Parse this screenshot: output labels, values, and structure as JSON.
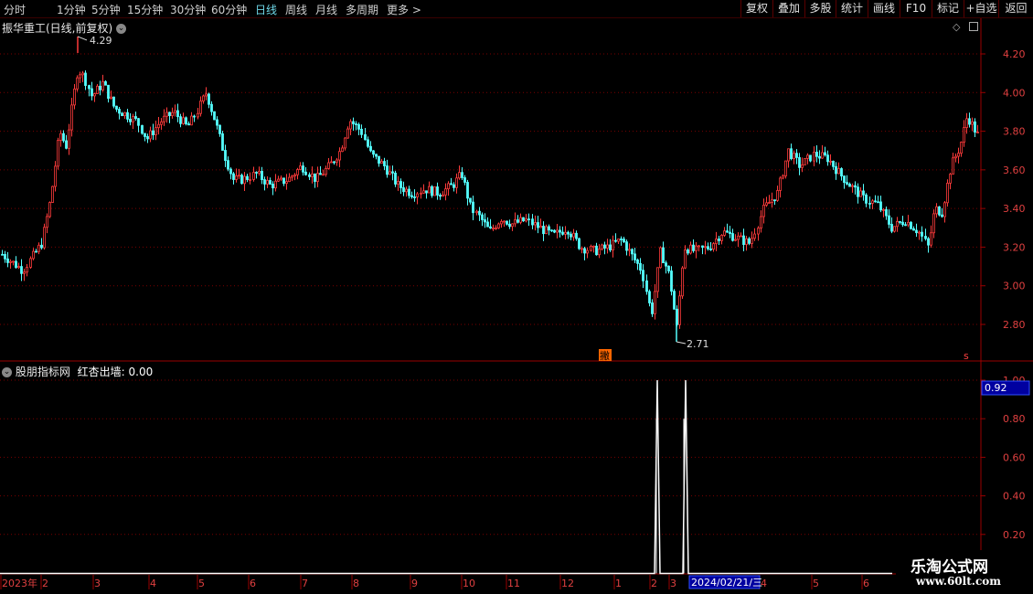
{
  "toolbar": {
    "periods": [
      "分时",
      "1分钟",
      "5分钟",
      "15分钟",
      "30分钟",
      "60分钟",
      "日线",
      "周线",
      "月线",
      "多周期",
      "更多 >"
    ],
    "active_period": "日线",
    "right_buttons": [
      "复权",
      "叠加",
      "多股",
      "统计",
      "画线",
      "F10",
      "标记",
      "+自选",
      "返回"
    ]
  },
  "main_chart": {
    "title": "振华重工(日线,前复权)",
    "y_axis_labels": [
      "4.20",
      "4.00",
      "3.80",
      "3.60",
      "3.40",
      "3.20",
      "3.00",
      "2.80"
    ],
    "high_label": "4.29",
    "low_label": "2.71",
    "signal_marker": "撇",
    "s_marker": "s",
    "colors": {
      "up": "#ff3b3b",
      "down": "#54ffff",
      "grid": "#7a0000",
      "frame": "#9a0000"
    }
  },
  "indicator": {
    "title": "股朋指标网",
    "line_label": "红杏出墙:",
    "line_value": "0.00",
    "y_axis_labels": [
      "1.00",
      "0.80",
      "0.60",
      "0.40",
      "0.20"
    ],
    "cursor_value": "0.92",
    "signal_color": "#ffffff"
  },
  "x_axis": {
    "labels": [
      "2023年",
      "2",
      "3",
      "4",
      "5",
      "6",
      "7",
      "8",
      "9",
      "10",
      "11",
      "12",
      "1",
      "2",
      "3",
      "4",
      "5",
      "6"
    ],
    "cursor_date": "2024/02/21/三"
  },
  "watermark": {
    "line1": "乐淘公式网",
    "line2": "www.60lt.com"
  },
  "chart_data": {
    "type": "candlestick",
    "title": "振华重工(日线,前复权)",
    "ylim": [
      2.65,
      4.35
    ],
    "period_high": 4.29,
    "period_low": 2.71,
    "price_path": [
      [
        0,
        3.17
      ],
      [
        25,
        3.08
      ],
      [
        45,
        3.22
      ],
      [
        55,
        3.45
      ],
      [
        65,
        3.8
      ],
      [
        72,
        3.72
      ],
      [
        85,
        4.12
      ],
      [
        92,
        4.08
      ],
      [
        100,
        3.98
      ],
      [
        112,
        4.05
      ],
      [
        125,
        3.92
      ],
      [
        140,
        3.88
      ],
      [
        150,
        3.85
      ],
      [
        160,
        3.76
      ],
      [
        175,
        3.85
      ],
      [
        190,
        3.9
      ],
      [
        205,
        3.82
      ],
      [
        215,
        3.9
      ],
      [
        225,
        4.0
      ],
      [
        235,
        3.85
      ],
      [
        245,
        3.68
      ],
      [
        255,
        3.55
      ],
      [
        265,
        3.55
      ],
      [
        280,
        3.58
      ],
      [
        295,
        3.52
      ],
      [
        315,
        3.55
      ],
      [
        330,
        3.62
      ],
      [
        345,
        3.55
      ],
      [
        360,
        3.62
      ],
      [
        372,
        3.7
      ],
      [
        382,
        3.86
      ],
      [
        395,
        3.8
      ],
      [
        405,
        3.68
      ],
      [
        420,
        3.62
      ],
      [
        435,
        3.52
      ],
      [
        450,
        3.48
      ],
      [
        465,
        3.5
      ],
      [
        480,
        3.48
      ],
      [
        495,
        3.52
      ],
      [
        505,
        3.58
      ],
      [
        515,
        3.4
      ],
      [
        525,
        3.35
      ],
      [
        535,
        3.28
      ],
      [
        548,
        3.35
      ],
      [
        560,
        3.32
      ],
      [
        575,
        3.34
      ],
      [
        590,
        3.3
      ],
      [
        605,
        3.26
      ],
      [
        620,
        3.3
      ],
      [
        635,
        3.2
      ],
      [
        650,
        3.18
      ],
      [
        665,
        3.2
      ],
      [
        680,
        3.24
      ],
      [
        692,
        3.15
      ],
      [
        702,
        3.08
      ],
      [
        712,
        2.85
      ],
      [
        722,
        3.18
      ],
      [
        732,
        3.05
      ],
      [
        740,
        2.78
      ],
      [
        748,
        3.2
      ],
      [
        760,
        3.18
      ],
      [
        775,
        3.2
      ],
      [
        790,
        3.28
      ],
      [
        805,
        3.25
      ],
      [
        820,
        3.22
      ],
      [
        835,
        3.4
      ],
      [
        850,
        3.48
      ],
      [
        862,
        3.7
      ],
      [
        875,
        3.62
      ],
      [
        890,
        3.68
      ],
      [
        905,
        3.66
      ],
      [
        918,
        3.58
      ],
      [
        930,
        3.52
      ],
      [
        945,
        3.45
      ],
      [
        960,
        3.42
      ],
      [
        975,
        3.3
      ],
      [
        990,
        3.34
      ],
      [
        1005,
        3.28
      ],
      [
        1015,
        3.2
      ],
      [
        1022,
        3.4
      ],
      [
        1030,
        3.38
      ],
      [
        1040,
        3.62
      ],
      [
        1050,
        3.72
      ],
      [
        1058,
        3.88
      ],
      [
        1065,
        3.82
      ],
      [
        1072,
        3.76
      ]
    ],
    "indicator_name": "红杏出墙",
    "indicator_signals": [
      {
        "date": "2024-02 (first spike)",
        "value": 1.0
      },
      {
        "date": "2024-02-21",
        "value": 1.0
      }
    ]
  }
}
